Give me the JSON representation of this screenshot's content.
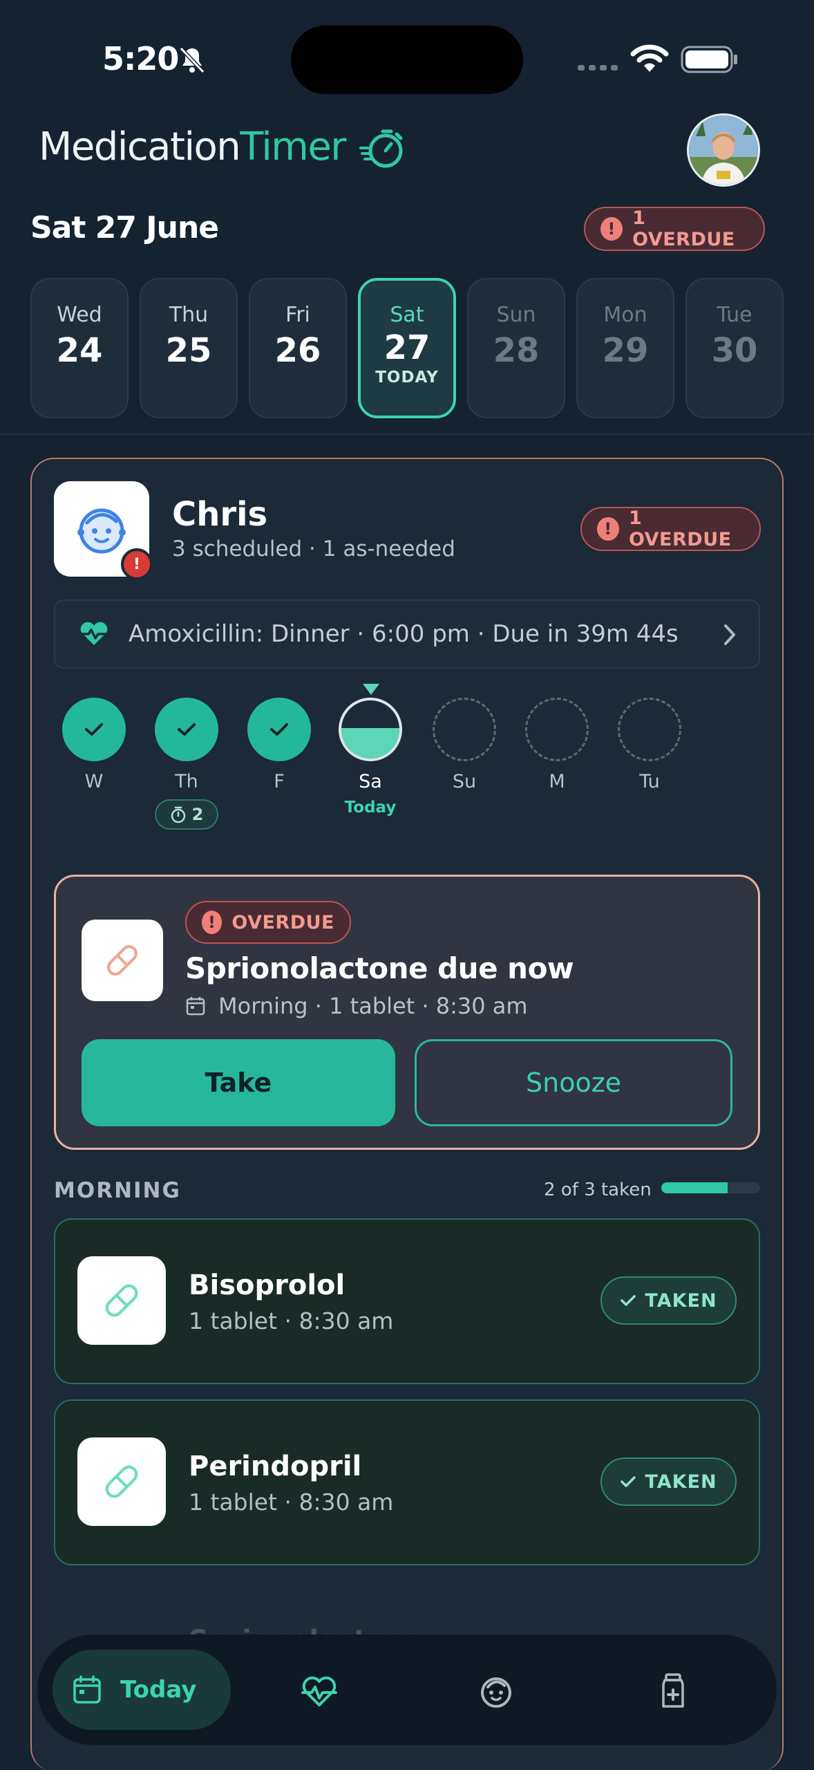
{
  "status_bar": {
    "time": "5:20"
  },
  "header": {
    "title_part1": "Medication",
    "title_part2": "Timer"
  },
  "date_bar": {
    "date": "Sat 27 June",
    "overdue": "1 OVERDUE"
  },
  "days": [
    {
      "name": "Wed",
      "num": "24"
    },
    {
      "name": "Thu",
      "num": "25"
    },
    {
      "name": "Fri",
      "num": "26"
    },
    {
      "name": "Sat",
      "num": "27",
      "tag": "TODAY"
    },
    {
      "name": "Sun",
      "num": "28"
    },
    {
      "name": "Mon",
      "num": "29"
    },
    {
      "name": "Tue",
      "num": "30"
    }
  ],
  "profile": {
    "name": "Chris",
    "summary": "3 scheduled · 1 as-needed",
    "overdue": "1 OVERDUE",
    "next_dose": "Amoxicillin: Dinner · 6:00 pm · Due in 39m 44s"
  },
  "week": [
    {
      "label": "W",
      "state": "done"
    },
    {
      "label": "Th",
      "state": "done"
    },
    {
      "label": "F",
      "state": "done"
    },
    {
      "label": "Sa",
      "state": "partial",
      "progress": 0.5
    },
    {
      "label": "Su",
      "state": "empty"
    },
    {
      "label": "M",
      "state": "empty"
    },
    {
      "label": "Tu",
      "state": "empty"
    }
  ],
  "week_today_label": "Today",
  "week_timer_count": "2",
  "overdue_card": {
    "badge": "OVERDUE",
    "title": "Sprionolactone due now",
    "detail": "Morning · 1 tablet · 8:30 am",
    "take_label": "Take",
    "snooze_label": "Snooze"
  },
  "morning": {
    "title": "MORNING",
    "count": "2 of 3 taken",
    "progress": 0.67,
    "meds": [
      {
        "name": "Bisoprolol",
        "detail": "1 tablet · 8:30 am",
        "status": "TAKEN"
      },
      {
        "name": "Perindopril",
        "detail": "1 tablet · 8:30 am",
        "status": "TAKEN"
      },
      {
        "name": "Sprionolactone",
        "detail": ""
      }
    ]
  },
  "nav": {
    "today_label": "Today"
  },
  "colors": {
    "accent": "#2fc8a5",
    "overdue": "#f07f7a",
    "background": "#152230"
  }
}
